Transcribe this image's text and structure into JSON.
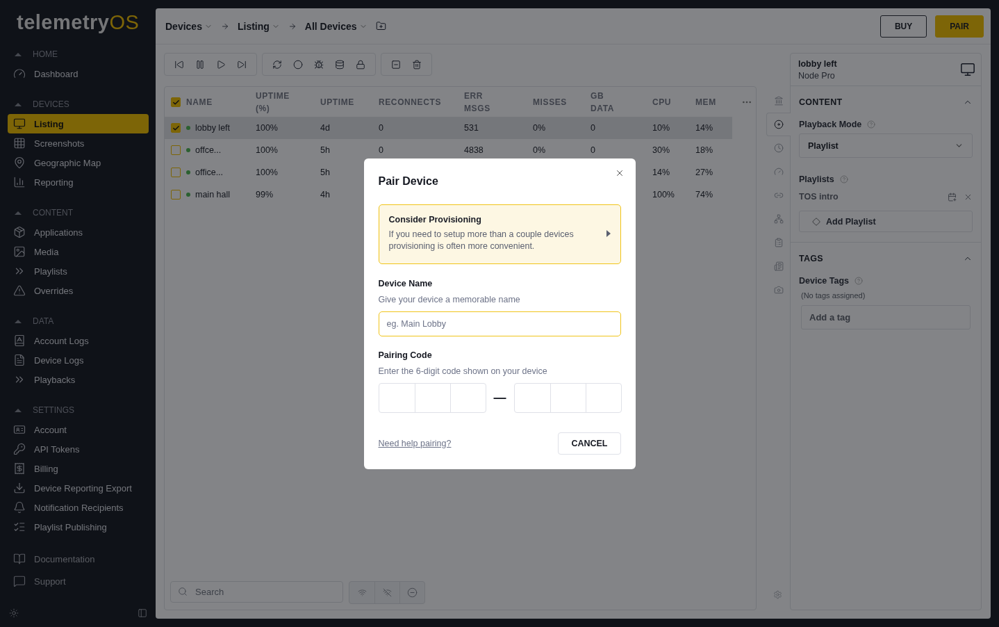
{
  "logo": {
    "main": "telemetry",
    "accent": "OS"
  },
  "sidebar": {
    "sections": [
      {
        "title": "HOME",
        "expanded": true,
        "items": [
          {
            "label": "Dashboard",
            "selected": false
          }
        ]
      },
      {
        "title": "DEVICES",
        "expanded": true,
        "items": [
          {
            "label": "Listing",
            "selected": true
          },
          {
            "label": "Screenshots",
            "selected": false
          },
          {
            "label": "Geographic Map",
            "selected": false
          },
          {
            "label": "Reporting",
            "selected": false
          }
        ]
      },
      {
        "title": "CONTENT",
        "expanded": true,
        "items": [
          {
            "label": "Applications",
            "selected": false
          },
          {
            "label": "Media",
            "selected": false
          },
          {
            "label": "Playlists",
            "selected": false
          },
          {
            "label": "Overrides",
            "selected": false
          }
        ]
      },
      {
        "title": "DATA",
        "expanded": true,
        "items": [
          {
            "label": "Account Logs",
            "selected": false
          },
          {
            "label": "Device Logs",
            "selected": false
          },
          {
            "label": "Playbacks",
            "selected": false
          }
        ]
      },
      {
        "title": "SETTINGS",
        "expanded": true,
        "items": [
          {
            "label": "Account",
            "selected": false
          },
          {
            "label": "API Tokens",
            "selected": false
          },
          {
            "label": "Billing",
            "selected": false
          },
          {
            "label": "Device Reporting Export",
            "selected": false
          },
          {
            "label": "Notification Recipients",
            "selected": false
          },
          {
            "label": "Playlist Publishing",
            "selected": false
          }
        ]
      }
    ],
    "links": [
      {
        "label": "Documentation"
      },
      {
        "label": "Support"
      }
    ]
  },
  "breadcrumbs": [
    {
      "label": "Devices"
    },
    {
      "label": "Listing"
    },
    {
      "label": "All Devices"
    }
  ],
  "header_buttons": [
    {
      "label": "BUY",
      "kind": "outline"
    },
    {
      "label": "PAIR",
      "kind": "primary"
    }
  ],
  "table": {
    "all_checked": true,
    "columns": [
      {
        "label": "NAME"
      },
      {
        "label": "UPTIME (%)"
      },
      {
        "label": "UPTIME"
      },
      {
        "label": "RECONNECTS"
      },
      {
        "label": "ERR MSGS"
      },
      {
        "label": "MISSES"
      },
      {
        "label": "GB DATA"
      },
      {
        "label": "CPU"
      },
      {
        "label": "MEM"
      }
    ],
    "rows": [
      {
        "checked": true,
        "selected": true,
        "online": true,
        "cells": [
          "lobby left",
          "100%",
          "4d",
          "0",
          "531",
          "0%",
          "0",
          "10%",
          "14%"
        ]
      },
      {
        "checked": false,
        "selected": false,
        "online": true,
        "cells": [
          "offce...",
          "100%",
          "5h",
          "0",
          "4838",
          "0%",
          "0",
          "30%",
          "18%"
        ]
      },
      {
        "checked": false,
        "selected": false,
        "online": true,
        "cells": [
          "office...",
          "100%",
          "5h",
          null,
          null,
          null,
          null,
          "14%",
          "27%"
        ]
      },
      {
        "checked": false,
        "selected": false,
        "online": true,
        "cells": [
          "main hall",
          "99%",
          "4h",
          null,
          null,
          null,
          null,
          "100%",
          "74%"
        ]
      }
    ]
  },
  "search": {
    "placeholder": "Search"
  },
  "rail_tabs": [
    {
      "selected": false
    },
    {
      "selected": true
    },
    {
      "selected": false
    },
    {
      "selected": false
    },
    {
      "selected": false
    },
    {
      "selected": false
    },
    {
      "selected": false
    },
    {
      "selected": false
    },
    {
      "selected": false
    }
  ],
  "device_panel": {
    "name": "lobby left",
    "model": "Node Pro",
    "content": {
      "title": "CONTENT",
      "expanded": true,
      "playback_mode_label": "Playback Mode",
      "playback_mode": "Playlist",
      "playlists_label": "Playlists",
      "playlists": [
        {
          "name": "TOS intro"
        }
      ],
      "add_button": "Add Playlist"
    },
    "tags": {
      "title": "TAGS",
      "expanded": true,
      "label": "Device Tags",
      "empty": "(No tags assigned)",
      "placeholder": "Add a tag"
    }
  },
  "modal": {
    "title": "Pair Device",
    "callout_title": "Consider Provisioning",
    "callout_body": "If you need to setup more than a couple devices provisioning is often more convenient.",
    "name_label": "Device Name",
    "name_hint": "Give your device a memorable name",
    "name_placeholder": "eg. Main Lobby",
    "code_label": "Pairing Code",
    "code_hint": "Enter the 6-digit code shown on your device",
    "code_separator": "—",
    "help_link": "Need help pairing?",
    "cancel": "CANCEL"
  }
}
